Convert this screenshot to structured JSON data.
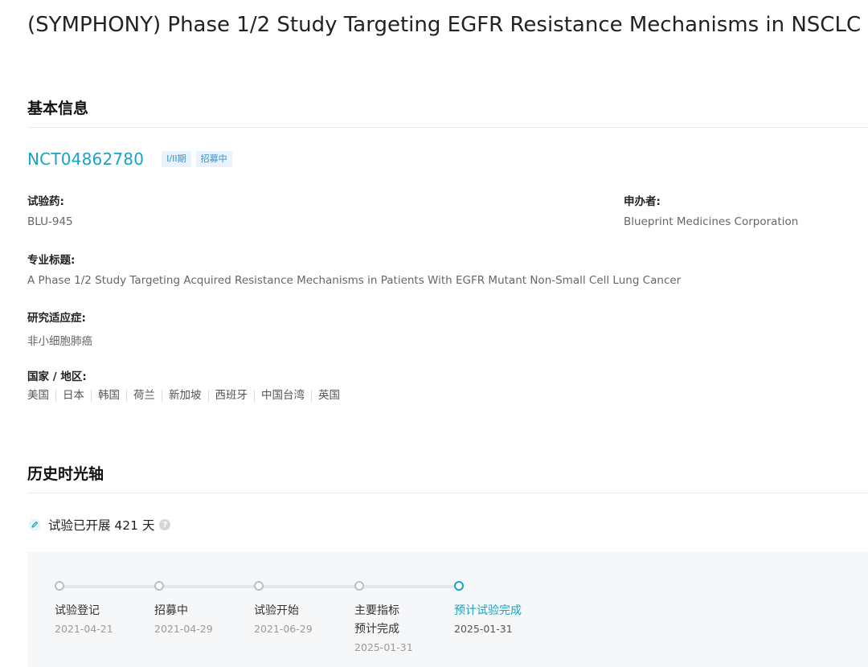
{
  "page": {
    "title": "(SYMPHONY) Phase 1/2 Study Targeting EGFR Resistance Mechanisms in NSCLC"
  },
  "basic_info": {
    "heading": "基本信息",
    "trial_id": "NCT04862780",
    "tags": [
      "I/II期",
      "招募中"
    ],
    "drug_label": "试验药:",
    "drug_value": "BLU-945",
    "sponsor_label": "申办者:",
    "sponsor_value": "Blueprint Medicines Corporation",
    "official_title_label": "专业标题:",
    "official_title_value": "A Phase 1/2 Study Targeting Acquired Resistance Mechanisms in Patients With EGFR Mutant Non-Small Cell Lung Cancer",
    "indication_label": "研究适应症:",
    "indication_value": "非小细胞肺癌",
    "countries_label": "国家 / 地区:",
    "countries": [
      "美国",
      "日本",
      "韩国",
      "荷兰",
      "新加坡",
      "西班牙",
      "中国台湾",
      "英国"
    ]
  },
  "timeline": {
    "heading": "历史时光轴",
    "duration_text": "试验已开展 421 天",
    "help_glyph": "?",
    "milestones": [
      {
        "label": "试验登记",
        "date": "2021-04-21",
        "active": false
      },
      {
        "label": "招募中",
        "date": "2021-04-29",
        "active": false
      },
      {
        "label": "试验开始",
        "date": "2021-06-29",
        "active": false
      },
      {
        "label_line1": "主要指标",
        "label_line2": "预计完成",
        "date": "2025-01-31",
        "active": false
      },
      {
        "label": "预计试验完成",
        "date": "2025-01-31",
        "active": true
      }
    ]
  },
  "colors": {
    "accent": "#1aa3c4",
    "tag_text": "#3a8fc8",
    "tag_bg": "#e8f3fb"
  }
}
